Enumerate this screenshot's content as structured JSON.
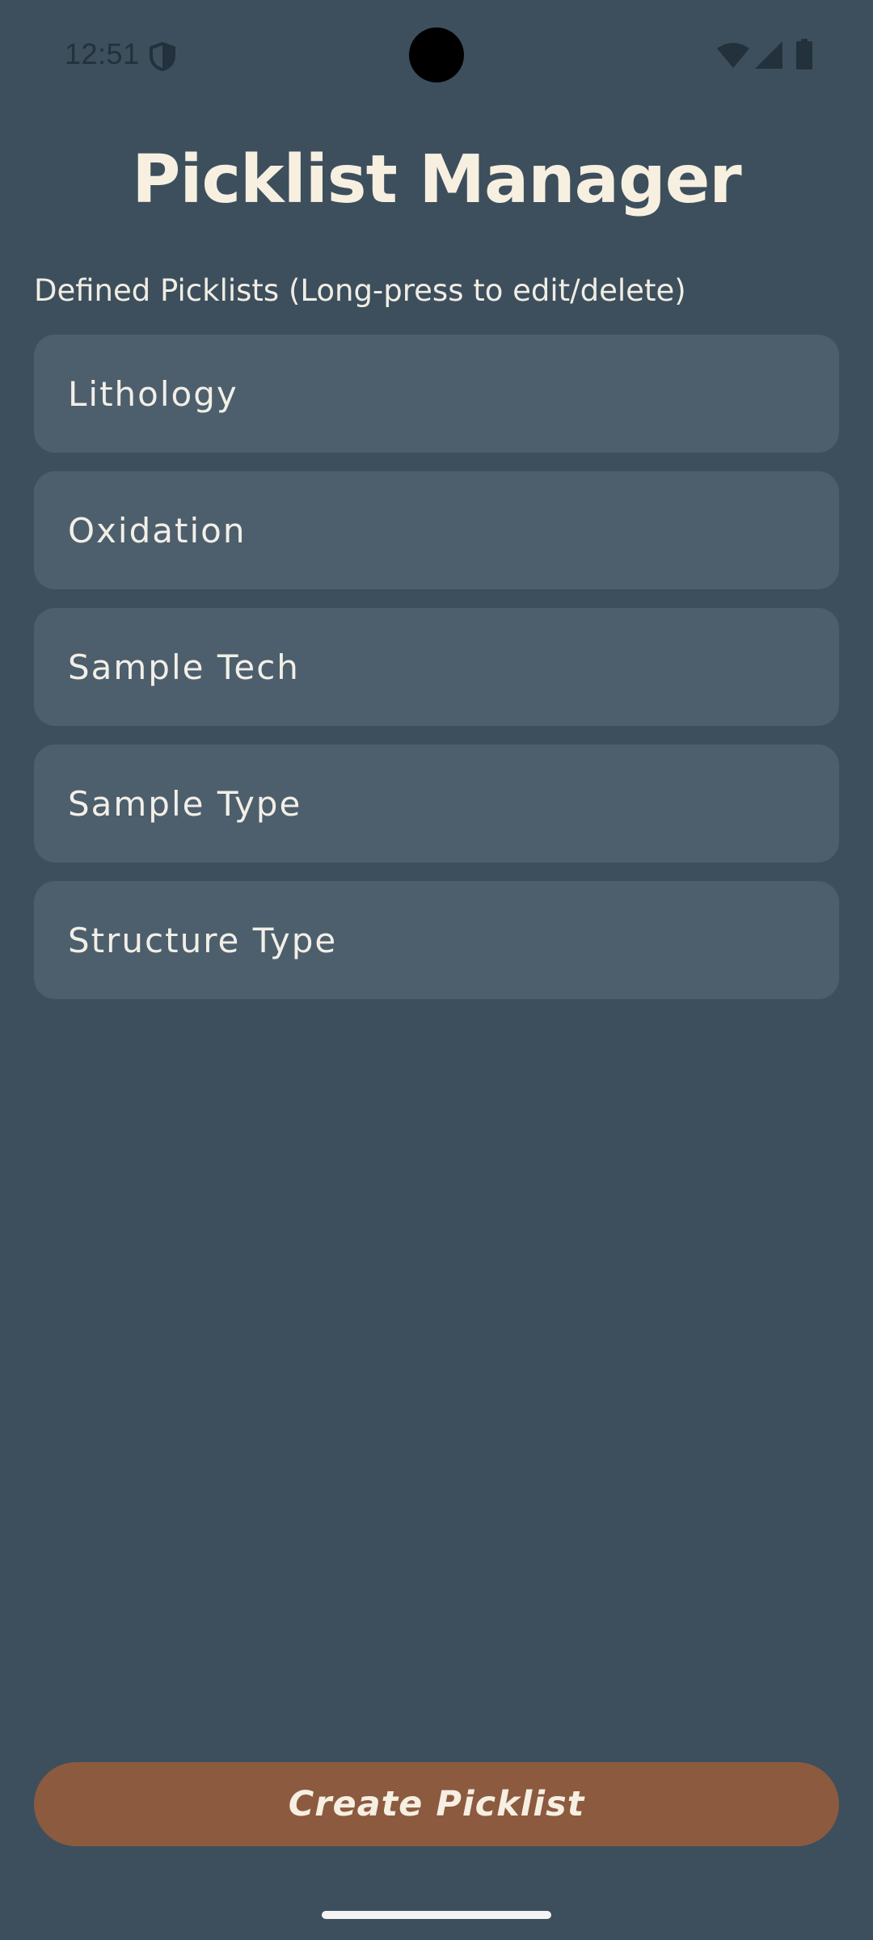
{
  "status_bar": {
    "time": "12:51",
    "icons": [
      "shield-icon",
      "wifi-icon",
      "signal-icon",
      "battery-icon"
    ]
  },
  "header": {
    "title": "Picklist Manager"
  },
  "main": {
    "section_label": "Defined Picklists (Long-press to edit/delete)",
    "picklists": [
      {
        "label": "Lithology"
      },
      {
        "label": "Oxidation"
      },
      {
        "label": "Sample Tech"
      },
      {
        "label": "Sample Type"
      },
      {
        "label": "Structure Type"
      }
    ]
  },
  "footer": {
    "create_label": "Create Picklist"
  },
  "colors": {
    "background": "#3d4f5c",
    "item_background": "#4d5f6c",
    "title_text": "#f7f0e0",
    "button_background": "#8c5a3f"
  }
}
